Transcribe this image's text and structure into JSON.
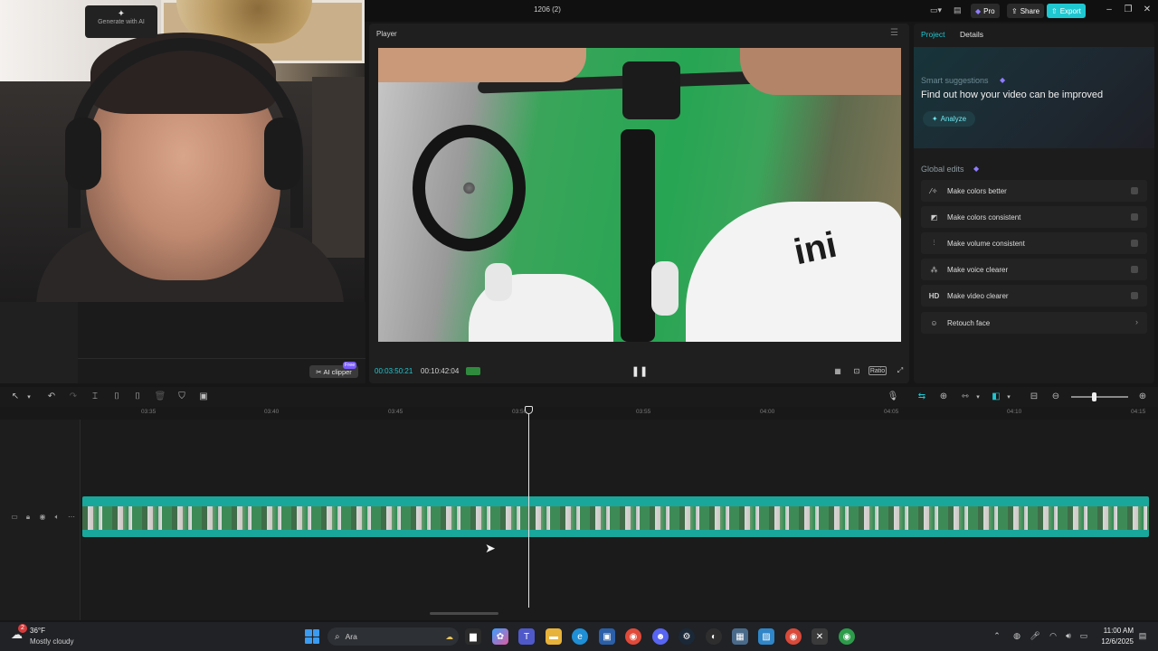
{
  "titlebar": {
    "title": "1206 (2)",
    "pro_label": "Pro",
    "share_label": "Share",
    "export_label": "Export"
  },
  "left_panel": {
    "generate_label": "Generate with AI",
    "ai_clipper_label": "AI clipper",
    "ai_clipper_badge": "Free"
  },
  "player": {
    "title": "Player",
    "time_current": "00:03:50:21",
    "time_total": "00:10:42:04",
    "ratio_label": "Ratio",
    "video_text": "ini"
  },
  "right_panel": {
    "tabs": [
      {
        "label": "Project",
        "active": true
      },
      {
        "label": "Details",
        "active": false
      }
    ],
    "smart": {
      "title": "Smart suggestions",
      "subtitle": "Find out how your video can be improved",
      "analyze_label": "Analyze"
    },
    "global_edits": {
      "title": "Global edits",
      "items": [
        {
          "label": "Make colors better",
          "icon": "wand-icon"
        },
        {
          "label": "Make colors consistent",
          "icon": "palette-icon"
        },
        {
          "label": "Make volume consistent",
          "icon": "sliders-icon"
        },
        {
          "label": "Make voice clearer",
          "icon": "voice-icon"
        },
        {
          "label": "Make video clearer",
          "icon": "hd-icon",
          "icon_text": "HD"
        },
        {
          "label": "Retouch face",
          "icon": "retouch-icon"
        }
      ]
    }
  },
  "timeline": {
    "ruler_labels": [
      "03:35",
      "03:40",
      "03:45",
      "03:50",
      "03:55",
      "04:00",
      "04:05",
      "04:10",
      "04:15"
    ]
  },
  "taskbar": {
    "weather_temp": "36°F",
    "weather_desc": "Mostly cloudy",
    "weather_badge": "2",
    "search_placeholder": "Ara",
    "clock_time": "11:00 AM",
    "clock_date": "12/6/2025"
  },
  "colors": {
    "accent": "#1fc7d1",
    "clip": "#19a79b",
    "premium": "#8f7cff"
  }
}
